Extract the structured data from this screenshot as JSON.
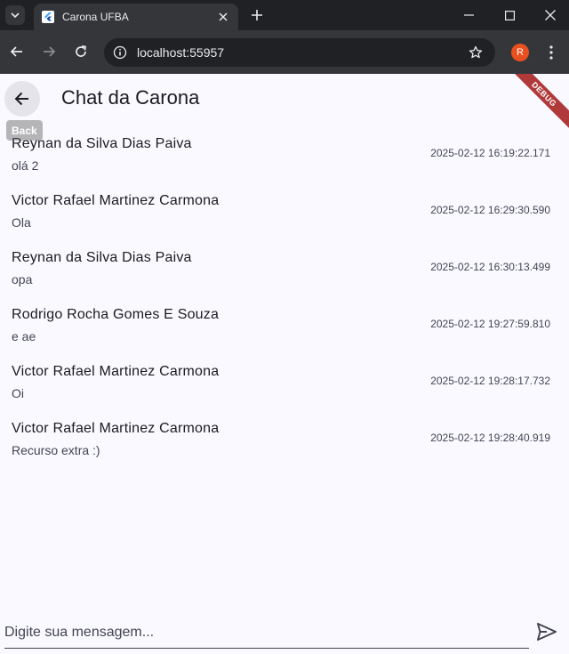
{
  "browser": {
    "tab_title": "Carona UFBA",
    "url": "localhost:55957",
    "profile_initial": "R",
    "profile_color": "#e8501f"
  },
  "app": {
    "title": "Chat da Carona",
    "back_tooltip": "Back",
    "debug_banner": "DEBUG",
    "messages": [
      {
        "sender": "Reynan da Silva Dias Paiva",
        "text": "olá 2",
        "time": "2025-02-12 16:19:22.171"
      },
      {
        "sender": "Victor Rafael Martinez Carmona",
        "text": "Ola",
        "time": "2025-02-12 16:29:30.590"
      },
      {
        "sender": "Reynan da Silva Dias Paiva",
        "text": "opa",
        "time": "2025-02-12 16:30:13.499"
      },
      {
        "sender": "Rodrigo Rocha Gomes E Souza",
        "text": "e ae",
        "time": "2025-02-12 19:27:59.810"
      },
      {
        "sender": "Victor Rafael Martinez Carmona",
        "text": "Oi",
        "time": "2025-02-12 19:28:17.732"
      },
      {
        "sender": "Victor Rafael Martinez Carmona",
        "text": "Recurso extra :)",
        "time": "2025-02-12 19:28:40.919"
      }
    ],
    "composer": {
      "placeholder": "Digite sua mensagem...",
      "value": ""
    }
  },
  "icons": {
    "back": "arrow-left-icon",
    "send": "send-icon",
    "favicon": "flutter-icon"
  }
}
